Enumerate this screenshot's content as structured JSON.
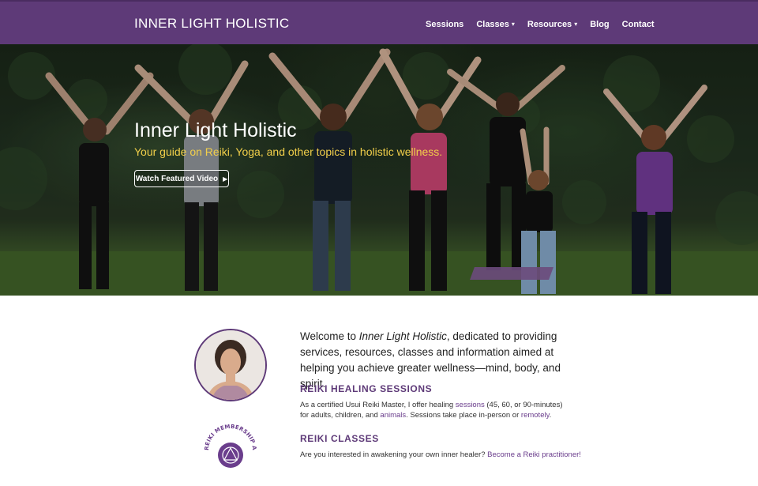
{
  "nav": {
    "brand": "INNER LIGHT HOLISTIC",
    "items": [
      {
        "label": "Sessions"
      },
      {
        "label": "Classes",
        "caret": "▾"
      },
      {
        "label": "Resources",
        "caret": "▾"
      },
      {
        "label": "Blog"
      },
      {
        "label": "Contact"
      }
    ]
  },
  "hero": {
    "title": "Inner Light Holistic",
    "subtitle": "Your guide on Reiki, Yoga, and other topics in holistic wellness.",
    "button_label": "Watch Featured Video",
    "button_icon": "▶"
  },
  "intro": {
    "welcome_pre": "Welcome to ",
    "welcome_em": "Inner Light Holistic",
    "welcome_post": ", dedicated to providing services, resources, classes and information aimed at helping you achieve greater wellness—mind, body, and spirit."
  },
  "sessions": {
    "heading": "REIKI HEALING SESSIONS",
    "t1": "As a certified Usui Reiki Master, I offer healing ",
    "link1": "sessions",
    "t2": " (45, 60, or 90-minutes) for adults, children, and ",
    "link2": "animals",
    "t3": ". Sessions take place in-person or ",
    "link3": "remotely",
    "t4": "."
  },
  "classes": {
    "heading": "REIKI CLASSES",
    "t1": "Are you interested in awakening your own inner healer?  ",
    "link1": "Become a Reiki practitioner!"
  },
  "logo": {
    "text": "REIKI MEMBERSHIP ASSOCIATION"
  },
  "colors": {
    "brand_purple": "#5e3a78",
    "subtitle_gold": "#f2cf4a",
    "link_purple": "#6a3d8c"
  }
}
